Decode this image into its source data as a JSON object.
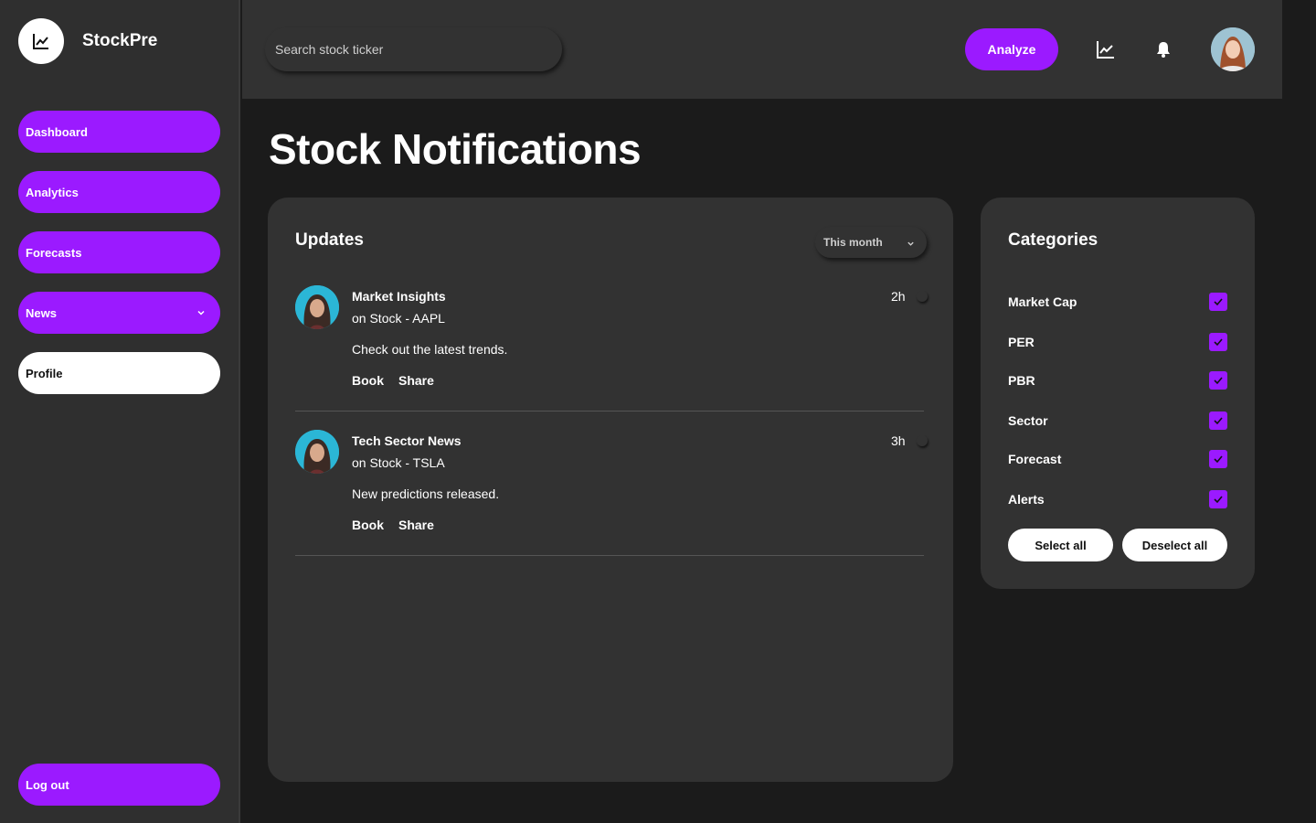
{
  "brand": {
    "name": "StockPre",
    "logo_icon": "chart-line-icon"
  },
  "sidebar": {
    "items": [
      {
        "label": "Dashboard"
      },
      {
        "label": "Analytics"
      },
      {
        "label": "Forecasts"
      },
      {
        "label": "News",
        "icon": "chevron-down-icon"
      },
      {
        "label": "Profile",
        "active": true
      }
    ],
    "logout_label": "Log out"
  },
  "topbar": {
    "search_placeholder": "Search stock ticker",
    "analyze_label": "Analyze",
    "icons": [
      "chart-icon",
      "bell-icon"
    ]
  },
  "page": {
    "title": "Stock Notifications"
  },
  "updates": {
    "title": "Updates",
    "filter_value": "This month",
    "items": [
      {
        "title": "Market Insights",
        "subtitle": "on Stock - AAPL",
        "body": "Check out the latest trends.",
        "time": "2h",
        "actions": [
          "Book",
          "Share"
        ]
      },
      {
        "title": "Tech Sector News",
        "subtitle": "on Stock - TSLA",
        "body": "New predictions released.",
        "time": "3h",
        "actions": [
          "Book",
          "Share"
        ]
      }
    ]
  },
  "categories": {
    "title": "Categories",
    "items": [
      {
        "label": "Market Cap",
        "checked": true
      },
      {
        "label": "PER",
        "checked": true
      },
      {
        "label": "PBR",
        "checked": true
      },
      {
        "label": "Sector",
        "checked": true
      },
      {
        "label": "Forecast",
        "checked": true
      },
      {
        "label": "Alerts",
        "checked": true
      }
    ],
    "select_all_label": "Select all",
    "deselect_all_label": "Deselect all"
  },
  "colors": {
    "accent": "#9b1aff",
    "sidebar_bg": "#2f2f2f",
    "panel_bg": "#323232",
    "page_bg": "#1b1b1b"
  }
}
